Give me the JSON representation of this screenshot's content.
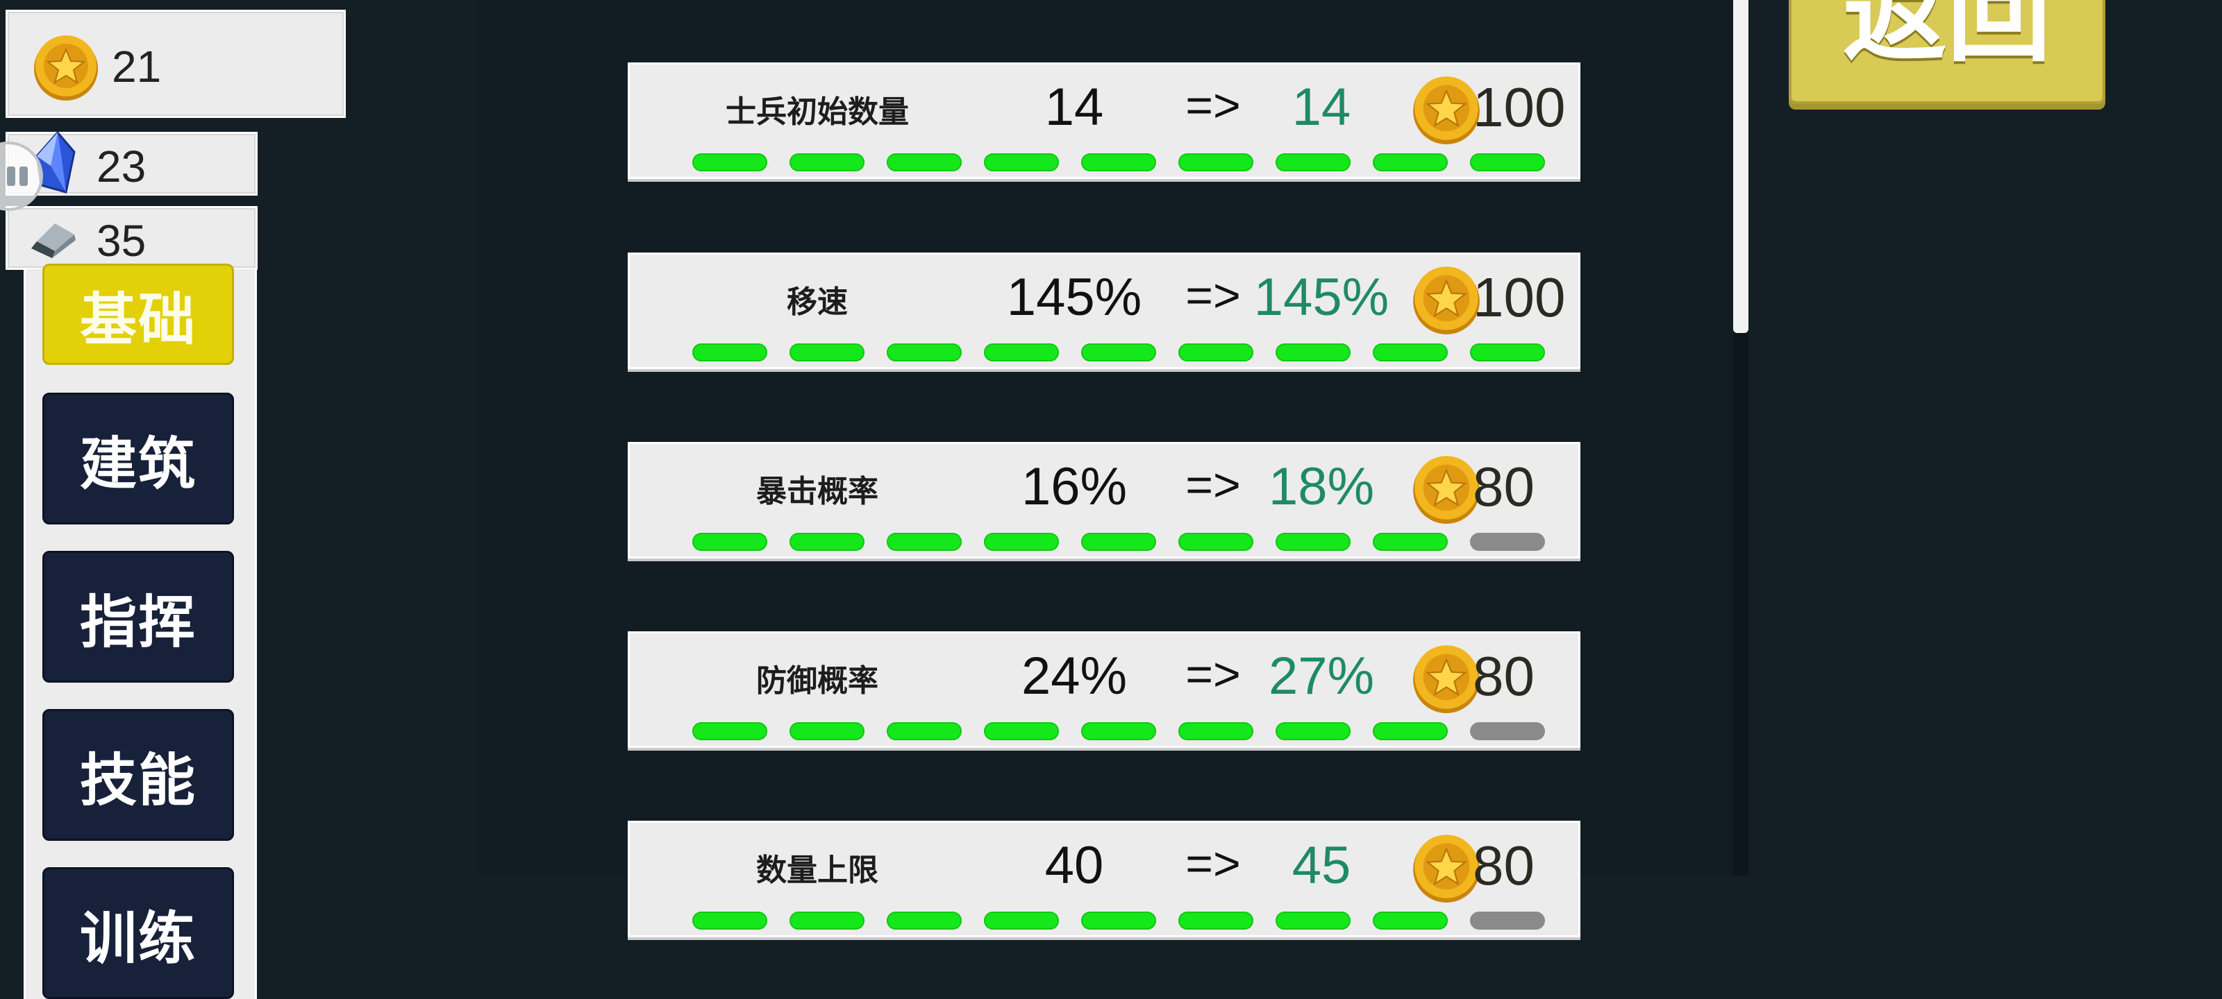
{
  "resources": {
    "gold": {
      "value": "21",
      "icon": "gold-coin-icon"
    },
    "gem": {
      "value": "23",
      "icon": "blue-gem-icon"
    },
    "iron": {
      "value": "35",
      "icon": "iron-ingot-icon"
    }
  },
  "menu": {
    "items": [
      {
        "label": "基础",
        "active": true
      },
      {
        "label": "建筑",
        "active": false
      },
      {
        "label": "指挥",
        "active": false
      },
      {
        "label": "技能",
        "active": false
      },
      {
        "label": "训练",
        "active": false
      }
    ]
  },
  "back_button": {
    "label": "返回"
  },
  "upgrades": [
    {
      "name": "士兵初始数量",
      "current": "14",
      "arrow": "=>",
      "next": "14",
      "cost": "100",
      "progress_filled": 9,
      "progress_total": 9
    },
    {
      "name": "移速",
      "current": "145%",
      "arrow": "=>",
      "next": "145%",
      "cost": "100",
      "progress_filled": 9,
      "progress_total": 9
    },
    {
      "name": "暴击概率",
      "current": "16%",
      "arrow": "=>",
      "next": "18%",
      "cost": "80",
      "progress_filled": 8,
      "progress_total": 9
    },
    {
      "name": "防御概率",
      "current": "24%",
      "arrow": "=>",
      "next": "27%",
      "cost": "80",
      "progress_filled": 8,
      "progress_total": 9
    },
    {
      "name": "数量上限",
      "current": "40",
      "arrow": "=>",
      "next": "45",
      "cost": "80",
      "progress_filled": 8,
      "progress_total": 9
    }
  ],
  "colors": {
    "background": "#131e25",
    "panel": "#ececec",
    "active_tab": "#e2d008",
    "tab": "#18213a",
    "next_value": "#1e8a66",
    "pip_on": "#15e81a",
    "pip_off": "#8a8a8a",
    "back_button": "#d9c955"
  }
}
